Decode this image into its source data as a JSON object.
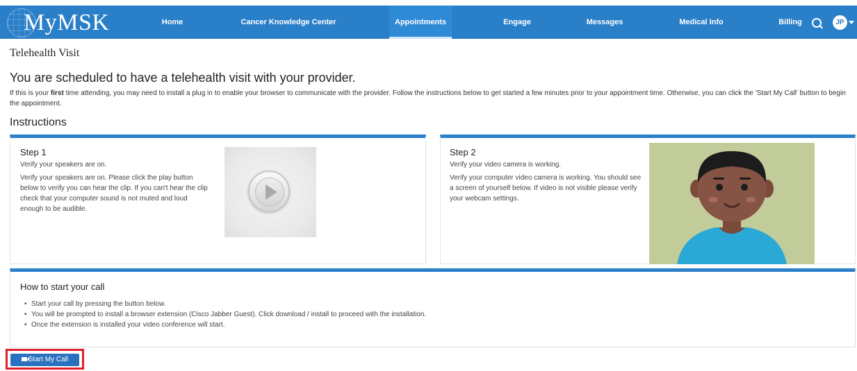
{
  "nav": {
    "logo": "MyMSK",
    "items": [
      {
        "label": "Home",
        "active": false
      },
      {
        "label": "Cancer Knowledge Center",
        "active": false
      },
      {
        "label": "Appointments",
        "active": true
      },
      {
        "label": "Engage",
        "active": false
      },
      {
        "label": "Messages",
        "active": false
      },
      {
        "label": "Medical Info",
        "active": false
      },
      {
        "label": "Billing",
        "active": false
      }
    ],
    "avatar_initials": "JP",
    "accent": "#2a7fc9"
  },
  "page": {
    "title": "Telehealth Visit",
    "heading": "You are scheduled to have a telehealth visit with your provider.",
    "intro_part1": "If this is your ",
    "intro_bold": "first",
    "intro_part2": " time attending, you may need to install a plug in to enable your browser to communicate with the provider. Follow the instructions below to get started a few minutes prior to your appointment time. Otherwise, you can click the 'Start My Call' button to begin the appointment.",
    "instructions_heading": "Instructions"
  },
  "step1": {
    "title": "Step 1",
    "subtitle": "Verify your speakers are on.",
    "body": "Verify your speakers are on. Please click the play button below to verify you can hear the clip. If you can't hear the clip check that your computer sound is not muted and loud enough to be audible."
  },
  "step2": {
    "title": "Step 2",
    "subtitle": "Verify your video camera is working.",
    "body": "Verify your computer video camera is working. You should see a screen of yourself below. If video is not visible please verify your webcam settings."
  },
  "how_to": {
    "title": "How to start your call",
    "items": [
      "Start your call by pressing the button below.",
      "You will be prompted to install a browser extension (Cisco Jabber Guest). Click download / install to proceed with the installation.",
      "Once the extension is installed your video conference will start."
    ]
  },
  "start_call": {
    "label": "Start My Call",
    "highlight_color": "#e0202c"
  }
}
